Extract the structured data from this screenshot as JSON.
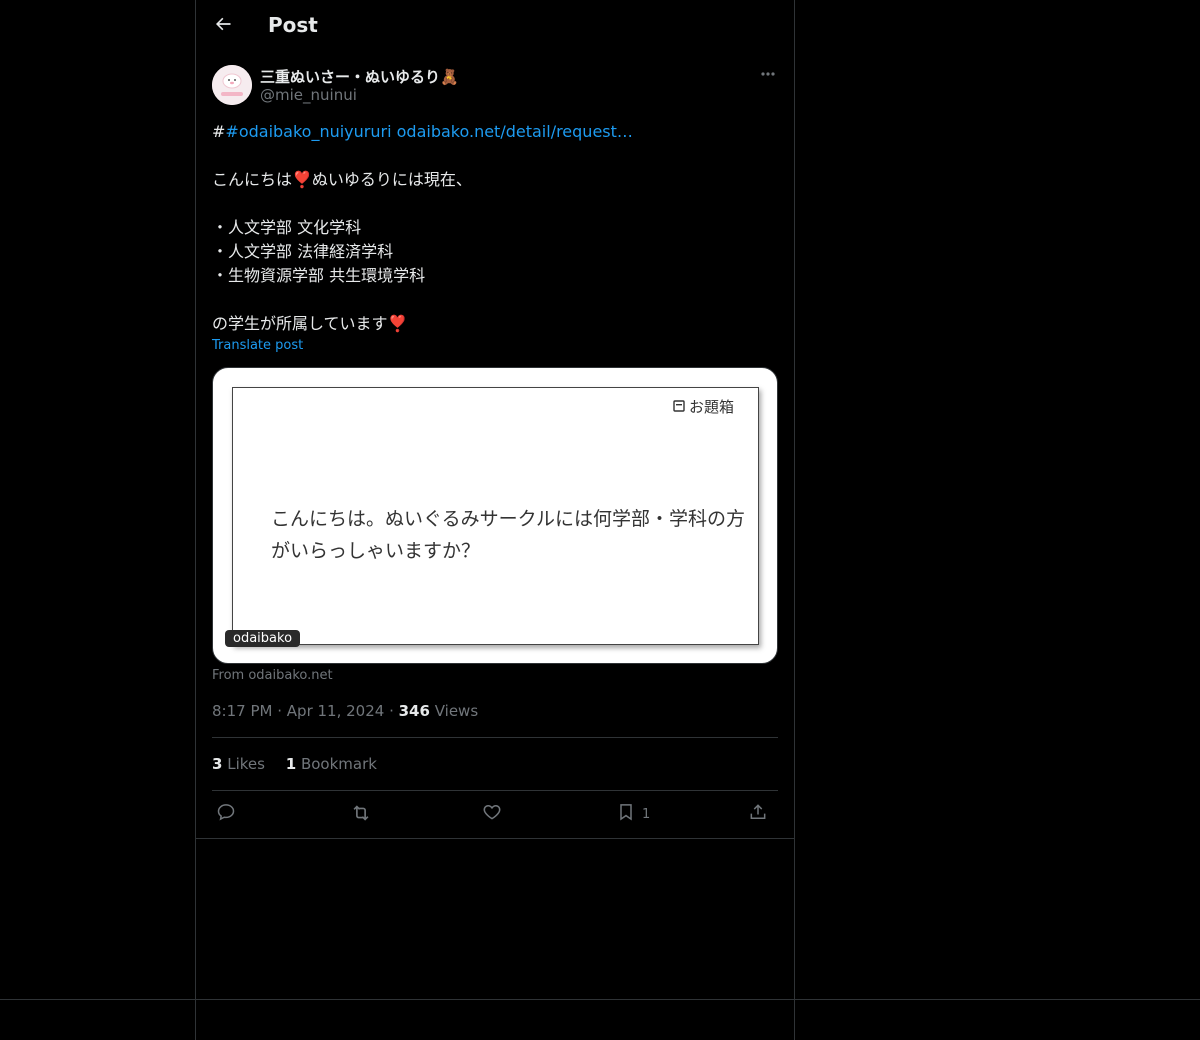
{
  "header": {
    "title": "Post"
  },
  "author": {
    "display_name": "三重ぬいさー・ぬいゆるり🧸",
    "handle": "@mie_nuinui"
  },
  "post": {
    "hash_prefix": "#",
    "hashtag": "#odaibako_nuiyururi",
    "link": "odaibako.net/detail/request…",
    "lines": [
      "こんにちは❣️ぬいゆるりには現在、",
      "",
      "・人文学部 文化学科",
      "・人文学部 法律経済学科",
      "・生物資源学部 共生環境学科",
      "",
      "の学生が所属しています❣️"
    ],
    "translate": "Translate post"
  },
  "card": {
    "label": "お題箱",
    "text": "こんにちは。ぬいぐるみサークルには何学部・学科の方がいらっしゃいますか？",
    "badge": "odaibako",
    "source": "From odaibako.net"
  },
  "meta": {
    "time": "8:17 PM",
    "date": "Apr 11, 2024",
    "views_count": "346",
    "views_label": "Views"
  },
  "stats": {
    "likes_count": "3",
    "likes_label": "Likes",
    "bookmarks_count": "1",
    "bookmarks_label": "Bookmark"
  },
  "actions": {
    "bookmark_count": "1"
  },
  "icons": {
    "back": "arrow-left-icon",
    "more": "more-horizontal-icon",
    "reply": "reply-icon",
    "repost": "repost-icon",
    "like": "heart-icon",
    "bookmark": "bookmark-icon",
    "share": "share-icon",
    "card_label": "box-icon"
  },
  "colors": {
    "link": "#1d9bf0",
    "background": "#000000",
    "secondary_text": "#71767b"
  }
}
